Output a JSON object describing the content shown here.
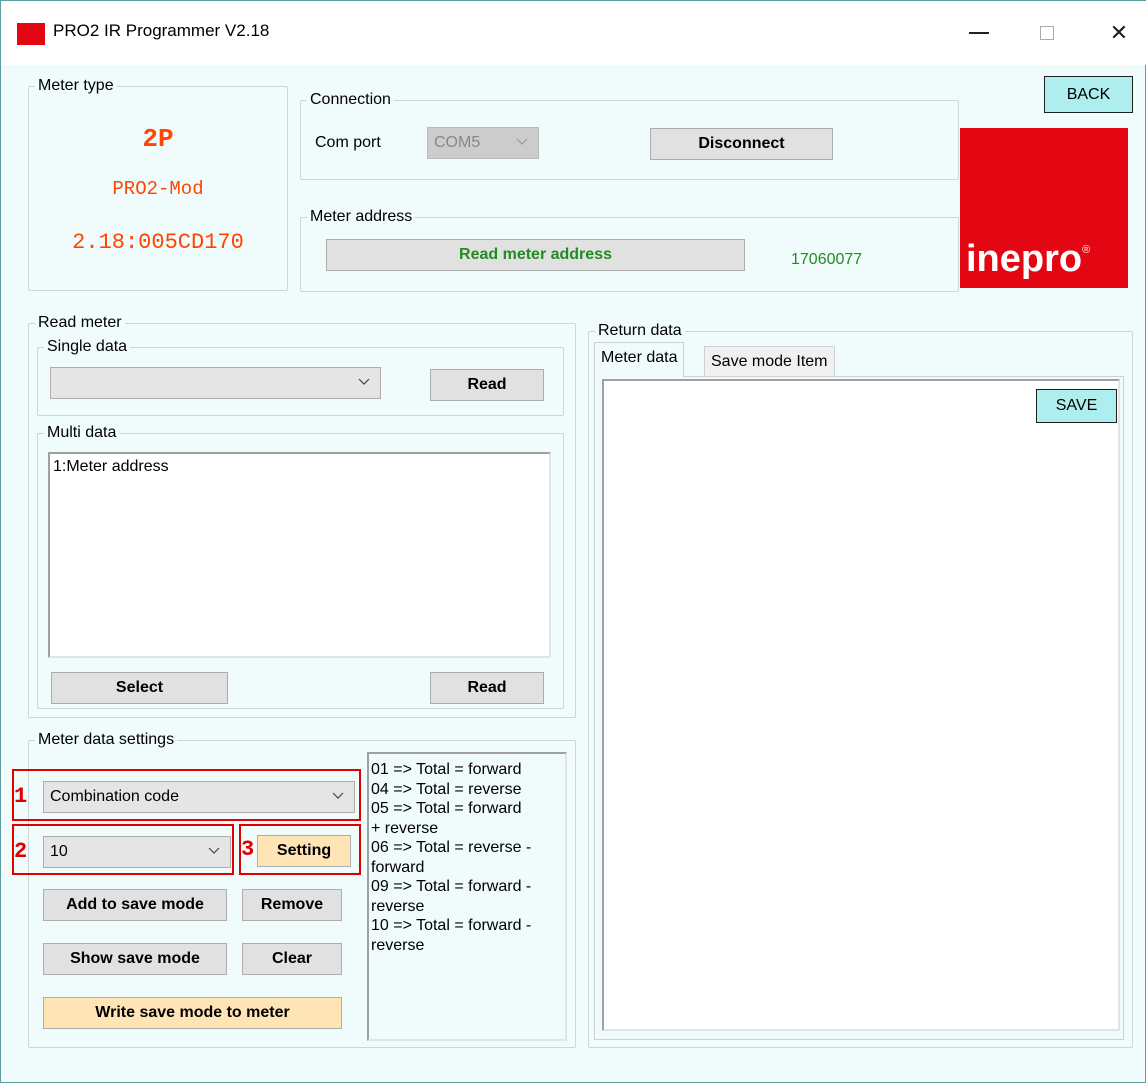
{
  "window": {
    "title": "PRO2 IR Programmer V2.18",
    "controls": {
      "minimize": "—",
      "close": "✕"
    }
  },
  "meter_type": {
    "legend": "Meter type",
    "phase": "2P",
    "model": "PRO2-Mod",
    "version": "2.18:005CD170",
    "color": "#ff4500"
  },
  "connection": {
    "legend": "Connection",
    "com_port_label": "Com port",
    "com_port_value": "COM5",
    "disconnect_label": "Disconnect"
  },
  "meter_address": {
    "legend": "Meter address",
    "read_button_label": "Read meter address",
    "value": "17060077",
    "value_color": "#228b22"
  },
  "back_button_label": "BACK",
  "logo": {
    "text": "inepro",
    "mark": "®",
    "brand_color": "#e30613"
  },
  "read_meter": {
    "legend": "Read meter",
    "single": {
      "legend": "Single data",
      "selected": "",
      "read_label": "Read"
    },
    "multi": {
      "legend": "Multi data",
      "items": [
        "1:Meter address"
      ],
      "select_label": "Select",
      "read_label": "Read"
    }
  },
  "settings": {
    "legend": "Meter data settings",
    "item_combo": "Combination code",
    "value_combo": "10",
    "setting_label": "Setting",
    "add_label": "Add to save mode",
    "remove_label": "Remove",
    "show_label": "Show save mode",
    "clear_label": "Clear",
    "write_label": "Write save mode to meter",
    "info_lines": [
      "01 => Total = forward",
      "04 => Total = reverse",
      "05 => Total = forward",
      "+ reverse",
      "06 => Total = reverse -",
      "forward",
      "09 => Total = forward -",
      "reverse",
      "10 => Total = forward -",
      "reverse"
    ],
    "annotations": [
      "1",
      "2",
      "3"
    ],
    "annotation_color": "#e00000"
  },
  "return_data": {
    "legend": "Return data",
    "tabs": [
      "Meter data",
      "Save mode Item"
    ],
    "save_label": "SAVE"
  },
  "icons": {
    "app": "app-icon",
    "minimize": "minimize-icon",
    "maximize": "maximize-icon",
    "close": "close-icon",
    "dropdown": "chevron-down-icon"
  }
}
